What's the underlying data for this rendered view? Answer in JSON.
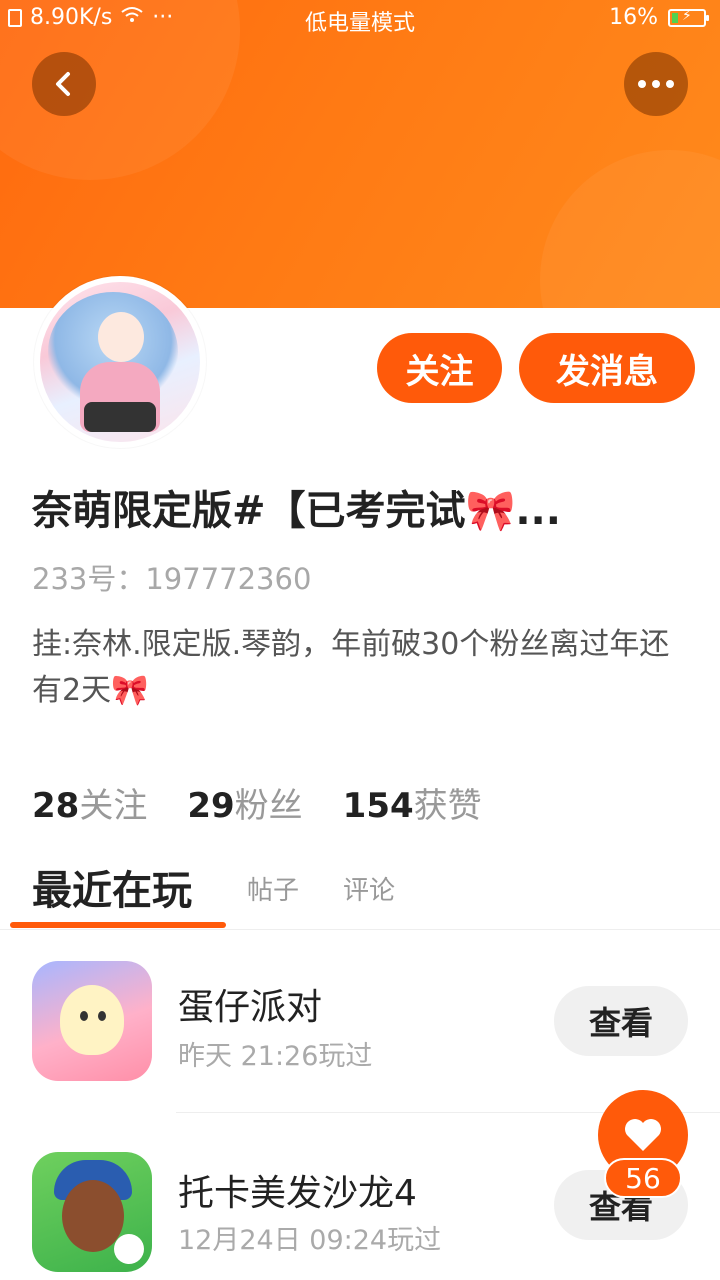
{
  "status_bar": {
    "speed": "8.90K/s",
    "dots": "···",
    "mode": "低电量模式",
    "battery": "16%"
  },
  "header": {
    "back_icon": "chevron-left-icon",
    "more_icon": "more-dots-icon",
    "accent_color": "#ff5a0a"
  },
  "profile": {
    "follow_label": "关注",
    "message_label": "发消息",
    "username": " 奈萌限定版#【已考完试🎀...",
    "uid": "233号：197772360",
    "bio": "挂:奈林.限定版.琴韵，年前破30个粉丝离过年还有2天🎀"
  },
  "stats": [
    {
      "num": "28",
      "label": "关注"
    },
    {
      "num": "29",
      "label": "粉丝"
    },
    {
      "num": "154",
      "label": "获赞"
    }
  ],
  "tabs": {
    "recent": "最近在玩",
    "posts": "帖子",
    "comments": "评论"
  },
  "games": [
    {
      "title": "蛋仔派对",
      "time": "昨天 21:26玩过",
      "action": "查看"
    },
    {
      "title": "托卡美发沙龙4",
      "time": "12月24日 09:24玩过",
      "action": "查看"
    }
  ],
  "like": {
    "count": "56",
    "icon": "heart-icon"
  }
}
